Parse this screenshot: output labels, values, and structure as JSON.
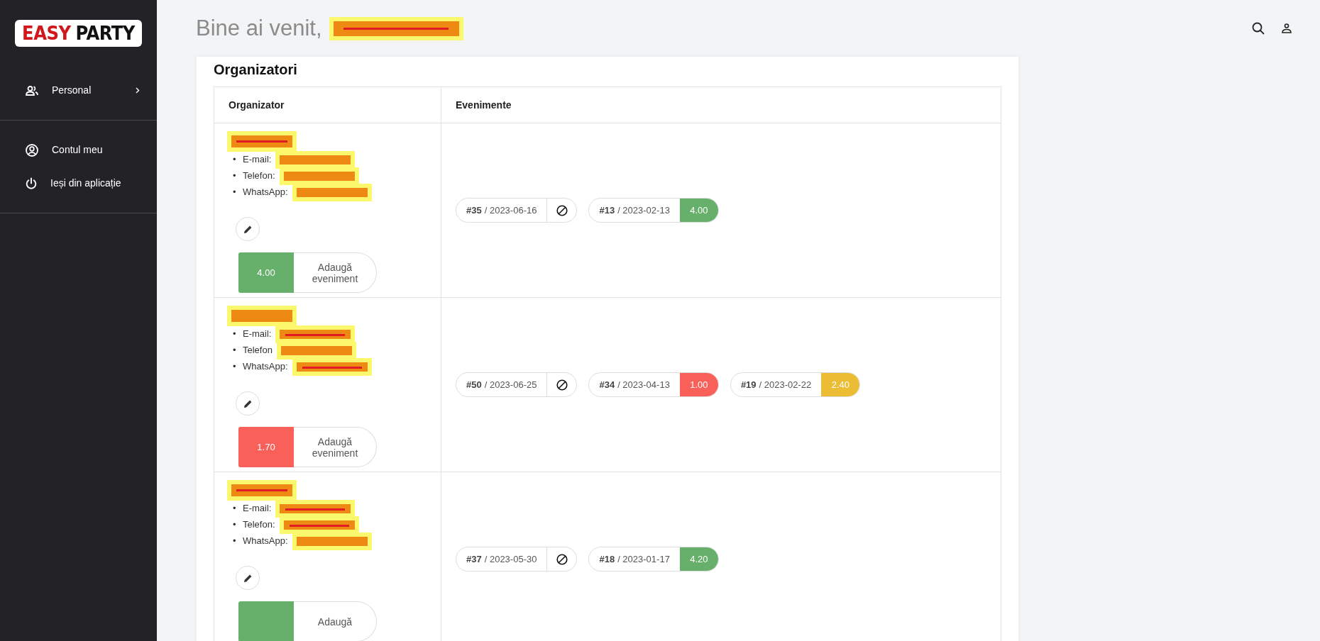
{
  "sidebar": {
    "logo": {
      "word_1": "EASY",
      "word_2": "PARTY"
    },
    "groups": [
      [
        {
          "label": "Personal",
          "has_submenu": true
        }
      ],
      [
        {
          "label": "Contul meu",
          "has_submenu": false
        },
        {
          "label": "Ieși din aplicație",
          "has_submenu": false
        }
      ]
    ]
  },
  "header": {
    "greeting": "Bine ai venit,",
    "name_redacted": true
  },
  "page": {
    "title": "Organizatori",
    "table": {
      "columns": [
        "Organizator",
        "Evenimente"
      ],
      "rows": [
        {
          "name_redacted": true,
          "contacts": [
            {
              "bullet": "•",
              "label": "E-mail:",
              "redacted": true
            },
            {
              "bullet": "•",
              "label": "Telefon:",
              "redacted": true
            },
            {
              "bullet": "•",
              "label": "WhatsApp:",
              "redacted": true
            }
          ],
          "score": "4.00",
          "color": "#66b06c",
          "add_label": "Adaugă eveniment",
          "events": [
            {
              "kind": "pending",
              "number": "#35",
              "date": "/ 2023-06-16"
            },
            {
              "kind": "rated",
              "number": "#13",
              "date": "/ 2023-02-13",
              "score": "4.00",
              "color": "#66b06c"
            }
          ]
        },
        {
          "name_redacted": true,
          "contacts": [
            {
              "bullet": "•",
              "label": "E-mail:",
              "redacted": true
            },
            {
              "bullet": "•",
              "label": "Telefon",
              "redacted": true
            },
            {
              "bullet": "•",
              "label": "WhatsApp:",
              "redacted": true
            }
          ],
          "score": "1.70",
          "color": "#f9605a",
          "add_label": "Adaugă eveniment",
          "events": [
            {
              "kind": "pending",
              "number": "#50",
              "date": "/ 2023-06-25"
            },
            {
              "kind": "rated",
              "number": "#34",
              "date": "/ 2023-04-13",
              "score": "1.00",
              "color": "#f9605a"
            },
            {
              "kind": "rated",
              "number": "#19",
              "date": "/ 2023-02-22",
              "score": "2.40",
              "color": "#ebbd35"
            }
          ]
        },
        {
          "name_redacted": true,
          "contacts": [
            {
              "bullet": "•",
              "label": "E-mail:",
              "redacted": true
            },
            {
              "bullet": "•",
              "label": "Telefon:",
              "redacted": true
            },
            {
              "bullet": "•",
              "label": "WhatsApp:",
              "redacted": true
            }
          ],
          "color": "#66b06c",
          "add_label": "Adaugă",
          "events": [
            {
              "kind": "pending",
              "number": "#37",
              "date": "/ 2023-05-30"
            },
            {
              "kind": "rated",
              "number": "#18",
              "date": "/ 2023-01-17",
              "score": "4.20",
              "color": "#66b06c"
            }
          ]
        }
      ]
    }
  }
}
